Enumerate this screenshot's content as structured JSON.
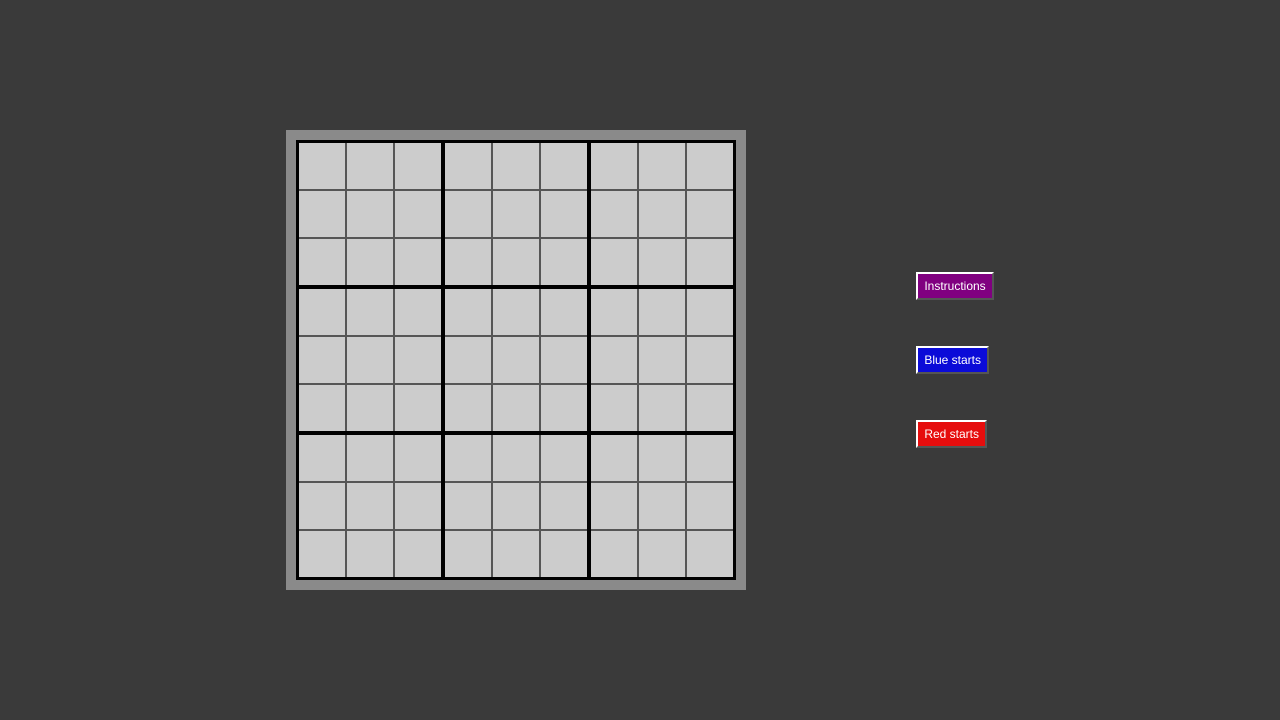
{
  "colors": {
    "page_bg": "#3a3a3a",
    "board_wrapper_bg": "#8a8a8a",
    "cell_bg": "#cccccc",
    "instructions_btn": "#800080",
    "blue_btn": "#0b0bd8",
    "red_btn": "#e60d0d"
  },
  "controls": {
    "instructions_label": "Instructions",
    "blue_label": "Blue starts",
    "red_label": "Red starts"
  },
  "board": {
    "big_rows": 3,
    "big_cols": 3,
    "small_rows": 3,
    "small_cols": 3,
    "cells": []
  }
}
